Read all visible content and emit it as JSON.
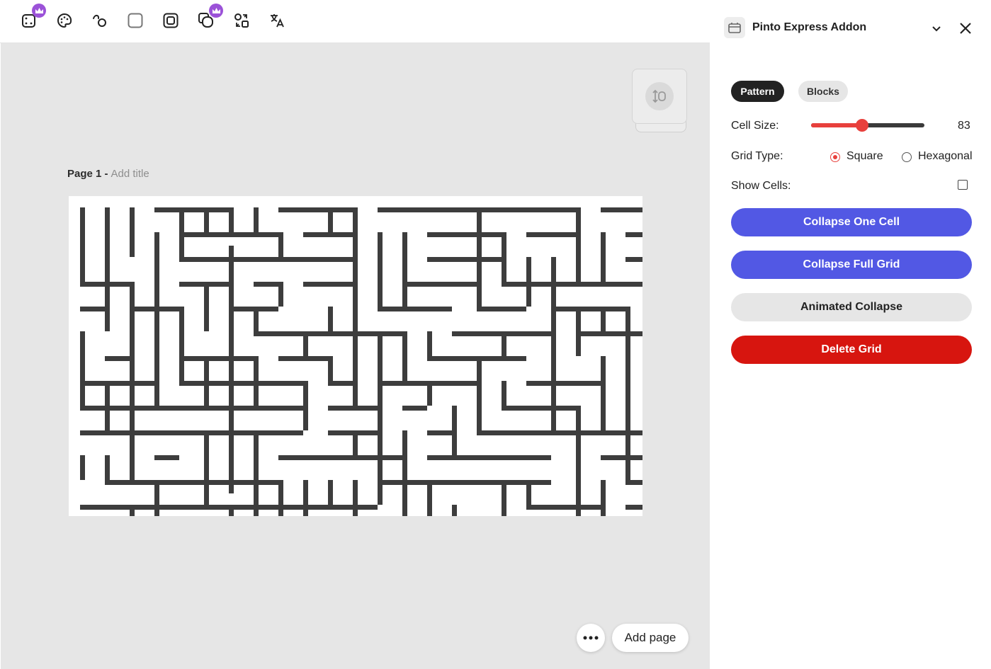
{
  "toolbar": {
    "tools": [
      {
        "icon": "dice-icon",
        "premium": true
      },
      {
        "icon": "palette-icon",
        "premium": false
      },
      {
        "icon": "scribble-icon",
        "premium": false
      },
      {
        "icon": "rounded-square-icon",
        "premium": false
      },
      {
        "icon": "framed-image-icon",
        "premium": true,
        "premium_note": "badge shown on 6th tool too"
      },
      {
        "icon": "layered-shapes-icon",
        "premium": true
      },
      {
        "icon": "swap-shapes-icon",
        "premium": false
      },
      {
        "icon": "translate-icon",
        "premium": false
      }
    ],
    "premium_badge_color": "#9b52d8"
  },
  "canvas": {
    "page_label": "Page 1 -",
    "title_placeholder": "Add title",
    "background_color": "#e6e6e6",
    "maze_color": "#3d3d3d",
    "more_icon": "ellipsis-icon",
    "add_page_label": "Add page"
  },
  "panel": {
    "title": "Pinto Express Addon",
    "tabs": [
      {
        "label": "Pattern",
        "active": true
      },
      {
        "label": "Blocks",
        "active": false
      }
    ],
    "cell_size": {
      "label": "Cell Size:",
      "value": 83,
      "fraction": 0.45
    },
    "grid_type": {
      "label": "Grid Type:",
      "options": [
        {
          "label": "Square",
          "checked": true
        },
        {
          "label": "Hexagonal",
          "checked": false
        }
      ]
    },
    "show_cells": {
      "label": "Show Cells:",
      "checked": false
    },
    "buttons": [
      {
        "label": "Collapse One Cell",
        "bg": "#5258e4",
        "fg": "#ffffff"
      },
      {
        "label": "Collapse Full Grid",
        "bg": "#5258e4",
        "fg": "#ffffff"
      },
      {
        "label": "Animated Collapse",
        "bg": "#e6e6e6",
        "fg": "#222222"
      },
      {
        "label": "Delete Grid",
        "bg": "#d7150f",
        "fg": "#ffffff"
      }
    ],
    "accent_color": "#e8403c"
  }
}
